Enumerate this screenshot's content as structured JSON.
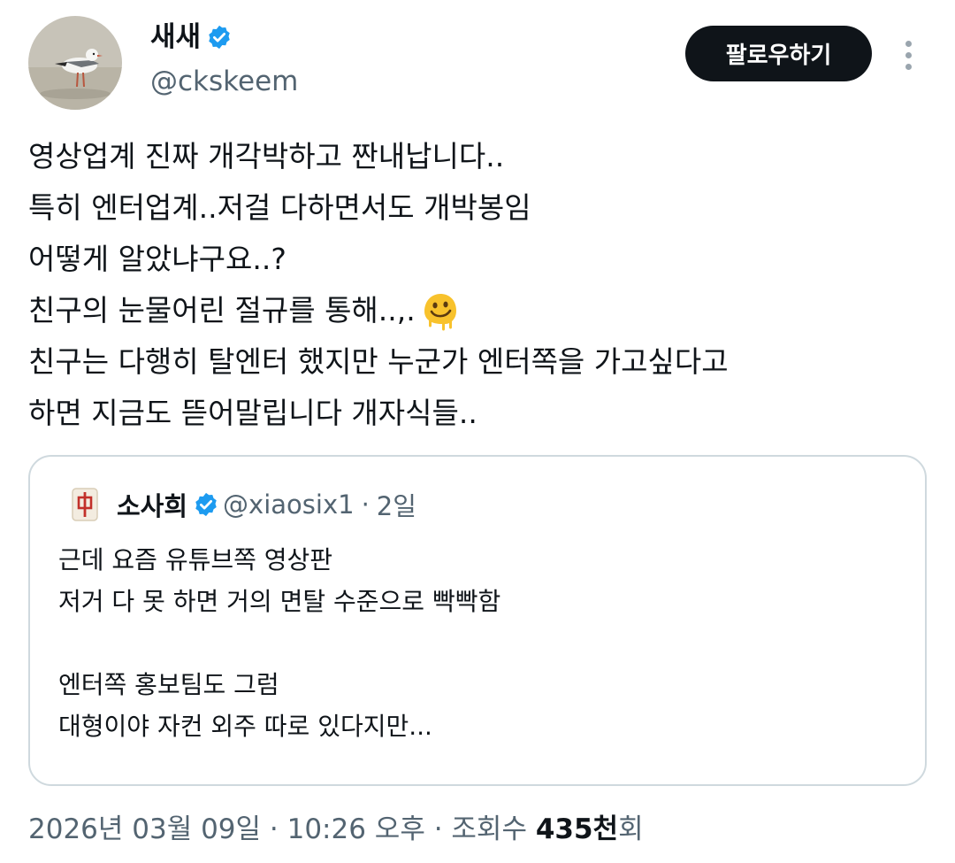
{
  "author": {
    "name": "새새",
    "handle": "@ckskeem",
    "verified_icon": "verified-badge-icon",
    "accent_color": "#1d9bf0"
  },
  "follow_button": {
    "label": "팔로우하기"
  },
  "more_menu": {
    "icon": "more-vertical-icon"
  },
  "tweet": {
    "lines": [
      "영상업계 진짜 개각박하고 짠내납니다..",
      "특히 엔터업계..저걸 다하면서도 개박봉임",
      "어떻게 알았냐구요..?",
      "친구의 눈물어린 절규를 통해..,.",
      "친구는 다행히 탈엔터 했지만 누군가 엔터쪽을 가고싶다고",
      "하면 지금도 뜯어말립니다 개자식들.."
    ],
    "emoji": "melting-face-emoji"
  },
  "quote": {
    "avatar_icon": "mahjong-tile-icon",
    "name": "소사희",
    "handle": "@xiaosix1",
    "separator": "·",
    "time": "2일",
    "lines": [
      "근데 요즘 유튜브쪽 영상판",
      "저거 다 못 하면 거의 면탈 수준으로 빡빡함",
      "",
      "엔터쪽 홍보팀도 그럼",
      "대형이야 자컨 외주 따로 있다지만..."
    ]
  },
  "meta": {
    "date_time": "2026년 03월 09일 · 10:26 오후 · 조회수 ",
    "views": "435천",
    "views_suffix": "회"
  }
}
